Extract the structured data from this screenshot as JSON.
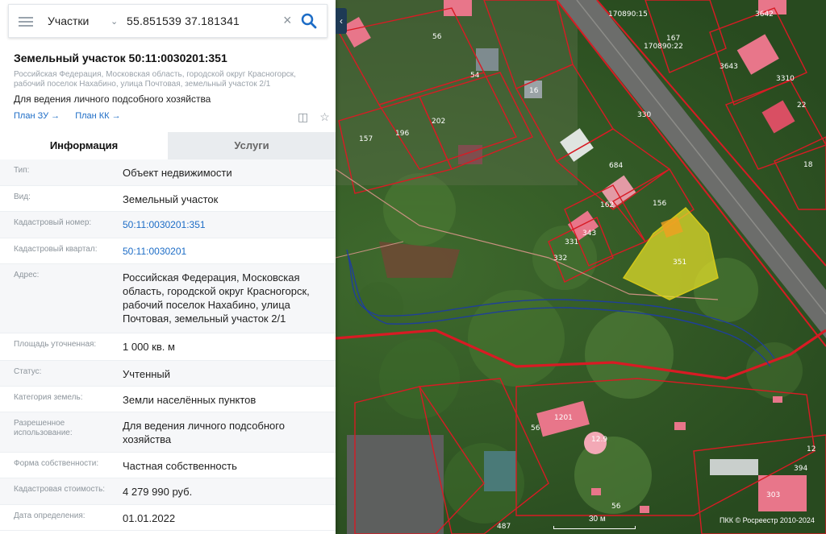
{
  "search": {
    "layer_select": "Участки",
    "query": "55.851539 37.181341"
  },
  "object": {
    "title": "Земельный участок 50:11:0030201:351",
    "address_short": "Российская Федерация, Московская область, городской округ Красногорск, рабочий поселок Нахабино, улица Почтовая, земельный участок 2/1",
    "purpose": "Для ведения личного подсобного хозяйства",
    "link_zu": "План ЗУ →",
    "link_kk": "План КК →"
  },
  "tabs": [
    "Информация",
    "Услуги"
  ],
  "info_rows": [
    {
      "key": "Тип:",
      "value": "Объект недвижимости"
    },
    {
      "key": "Вид:",
      "value": "Земельный участок"
    },
    {
      "key": "Кадастровый номер:",
      "value": "50:11:0030201:351"
    },
    {
      "key": "Кадастровый квартал:",
      "value": "50:11:0030201"
    },
    {
      "key": "Адрес:",
      "value": "Российская Федерация, Московская область, городской округ Красногорск, рабочий поселок Нахабино, улица Почтовая, земельный участок 2/1"
    },
    {
      "key": "Площадь уточненная:",
      "value": "1 000 кв. м"
    },
    {
      "key": "Статус:",
      "value": "Учтенный"
    },
    {
      "key": "Категория земель:",
      "value": "Земли населённых пунктов"
    },
    {
      "key": "Разрешенное использование:",
      "value": "Для ведения личного подсобного хозяйства"
    },
    {
      "key": "Форма собственности:",
      "value": "Частная собственность"
    },
    {
      "key": "Кадастровая стоимость:",
      "value": "4 279 990 руб."
    },
    {
      "key": "Дата определения:",
      "value": "01.01.2022"
    }
  ],
  "map": {
    "selected_plot_label": "351",
    "plot_labels": [
      "156",
      "162",
      "331",
      "332",
      "343",
      "684",
      "16",
      "54",
      "56",
      "202",
      "196",
      "157",
      "330",
      "170890:15",
      "170890:22",
      "167",
      "3642",
      "3643",
      "3310",
      "22",
      "18",
      "12",
      "394",
      "303",
      "487",
      "56",
      "1201",
      "12.9",
      "56"
    ],
    "scale_label": "30 м",
    "copyright": "ПКК © Росреестр 2010-2024",
    "colors": {
      "boundary": "#d81b24",
      "selected_fill": "#e6e02a",
      "roof_pink": "#e8768a"
    }
  }
}
